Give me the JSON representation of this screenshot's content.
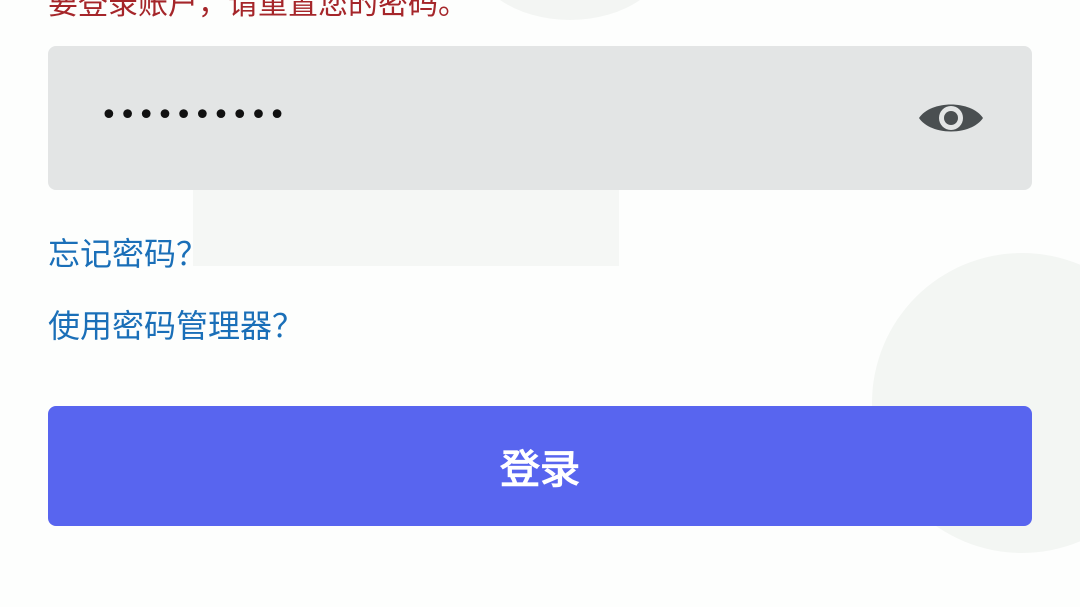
{
  "login": {
    "error_message": "要登录账户，请重置您的密码。",
    "password_value": "••••••••••",
    "reveal_icon": "eye-icon",
    "forgot_password_link": "忘记密码？",
    "password_manager_link": "使用密码管理器？",
    "submit_label": "登录"
  },
  "colors": {
    "error": "#a5262a",
    "link": "#1a6fb8",
    "button": "#5865ef",
    "field": "#e3e5e5"
  }
}
